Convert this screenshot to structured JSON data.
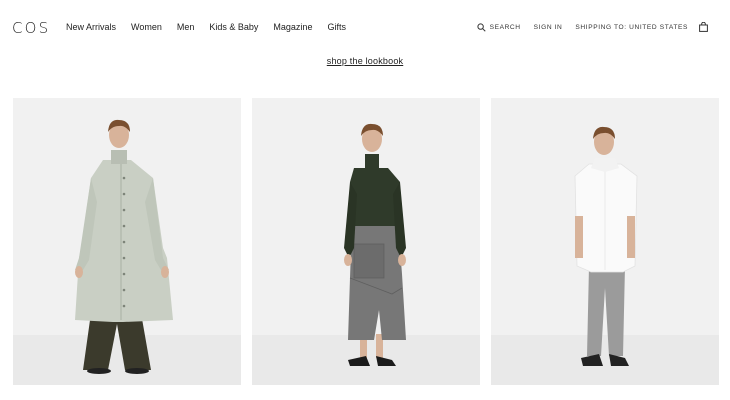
{
  "brand": {
    "logo": "COS"
  },
  "nav": {
    "items": [
      "New Arrivals",
      "Women",
      "Men",
      "Kids & Baby",
      "Magazine",
      "Gifts"
    ]
  },
  "utility": {
    "search_label": "SEARCH",
    "sign_in_label": "SIGN IN",
    "shipping_label": "SHIPPING TO: UNITED STATES"
  },
  "main": {
    "lookbook_link": "shop the lookbook",
    "looks": [
      {
        "subject": "model in pale sage long coat with buttons over turtleneck and dark wide trousers"
      },
      {
        "subject": "model in dark green fitted turtleneck top and grey asymmetric wrap skirt with pocket"
      },
      {
        "subject": "model in white sleeveless oversized shirt and light grey cropped trousers"
      }
    ]
  },
  "colors": {
    "background": "#ffffff",
    "panel": "#f1f1f1",
    "text": "#222222",
    "coat": "#c9cfc4",
    "top_green": "#2f3a2a",
    "skirt_grey": "#777777",
    "shirt_white": "#fafafa"
  }
}
